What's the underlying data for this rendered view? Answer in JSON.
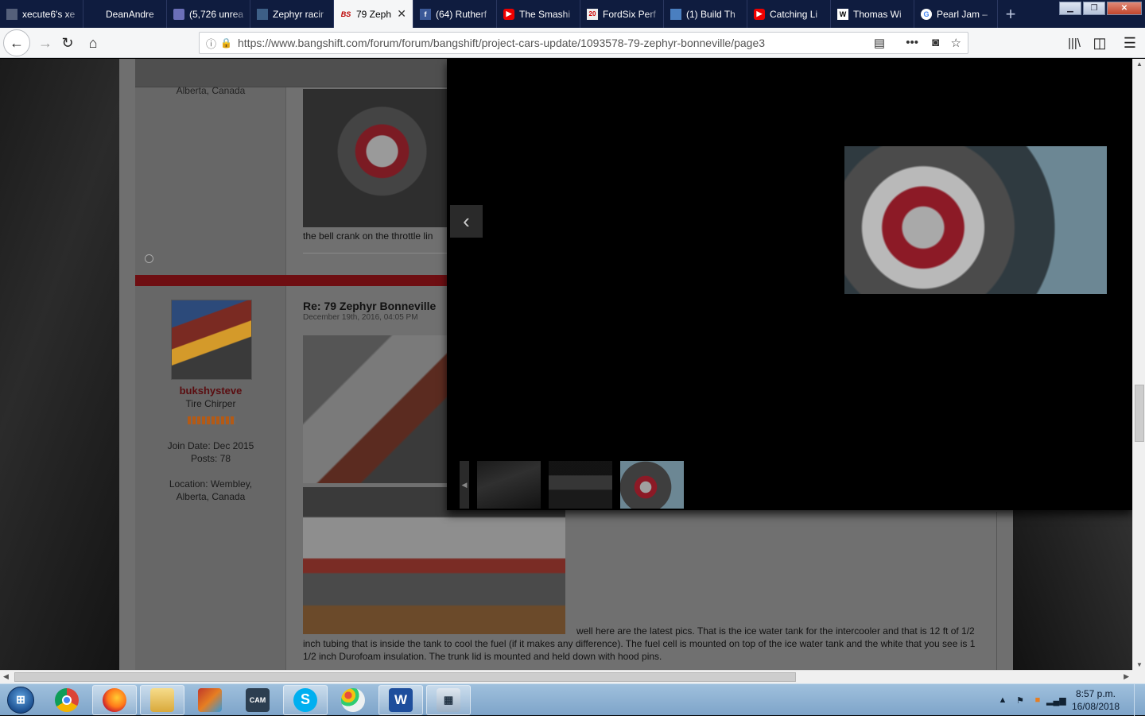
{
  "browser": {
    "tabs": [
      {
        "label": "xecute6's xe",
        "icon": "generic-icon",
        "active": false
      },
      {
        "label": "DeanAndre",
        "icon": "generic-icon",
        "active": false
      },
      {
        "label": "(5,726 unrea",
        "icon": "mail-icon",
        "active": false
      },
      {
        "label": "Zephyr racir",
        "icon": "site-icon",
        "active": false
      },
      {
        "label": "79 Zeph",
        "icon": "bangshift-icon",
        "favicon_text": "BS",
        "active": true
      },
      {
        "label": "(64) Rutherf",
        "icon": "facebook-icon",
        "favicon_text": "f",
        "active": false
      },
      {
        "label": "The Smashi",
        "icon": "youtube-icon",
        "active": false
      },
      {
        "label": "FordSix Perf",
        "icon": "fordsix-icon",
        "active": false
      },
      {
        "label": "(1) Build Th",
        "icon": "site-icon",
        "active": false
      },
      {
        "label": "Catching Li",
        "icon": "youtube-icon",
        "active": false
      },
      {
        "label": "Thomas Wi",
        "icon": "wikipedia-icon",
        "favicon_text": "W",
        "active": false
      },
      {
        "label": "Pearl Jam –",
        "icon": "google-icon",
        "favicon_text": "G",
        "active": false
      }
    ],
    "url": "https://www.bangshift.com/forum/forum/bangshift/project-cars-update/1093578-79-zephyr-bonneville/page3"
  },
  "forum": {
    "prev_location": "Alberta, Canada",
    "prev_caption": "the bell crank on the throttle lin",
    "post": {
      "title": "Re: 79 Zephyr Bonneville",
      "date": "December 19th, 2016, 04:05 PM",
      "text": "well here are the latest pics. That is the ice water tank for the intercooler and that is 12 ft of 1/2 inch tubing that is inside the tank to cool the fuel (if it makes any difference). The fuel cell is mounted on top of the ice water tank and the white that you see is 1 1/2 inch Durofoam insulation. The trunk lid is mounted and held down with hood pins."
    },
    "user": {
      "name": "bukshysteve",
      "title": "Tire Chirper",
      "join_date": "Join Date: Dec 2015",
      "posts": "Posts: 78",
      "location_line1": "Location: Wembley,",
      "location_line2": "Alberta, Canada"
    }
  },
  "lightbox": {
    "thumbnails": [
      "thumb-1",
      "thumb-2",
      "thumb-3"
    ],
    "selected_index": 2
  },
  "taskbar": {
    "time": "8:57 p.m.",
    "date": "16/08/2018",
    "apps": [
      "windows-start",
      "chrome",
      "firefox",
      "file-explorer",
      "paint-app",
      "webcam-app",
      "skype",
      "paint",
      "word",
      "calculator"
    ]
  },
  "colors": {
    "tab_bar": "#0f1c3f",
    "username": "#5a0d10",
    "separator_red": "#6e0e12"
  }
}
